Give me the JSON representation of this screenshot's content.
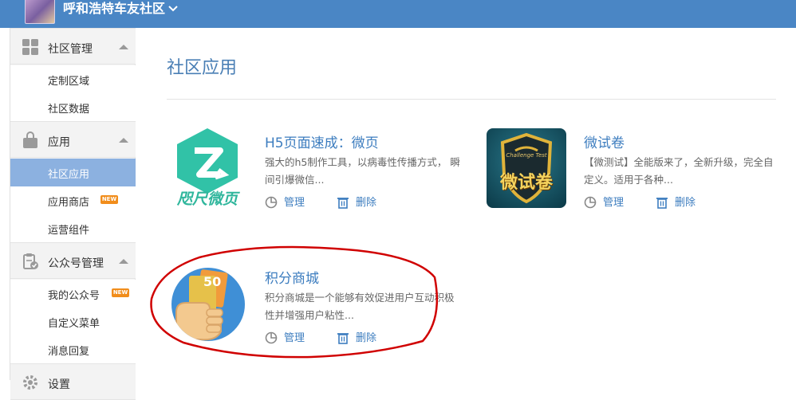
{
  "header": {
    "community_name": "呼和浩特车友社区"
  },
  "sidebar": {
    "sections": [
      {
        "label": "社区管理",
        "icon": "grid-icon",
        "items": [
          {
            "label": "定制区域"
          },
          {
            "label": "社区数据"
          }
        ]
      },
      {
        "label": "应用",
        "icon": "bag-icon",
        "items": [
          {
            "label": "社区应用",
            "active": true
          },
          {
            "label": "应用商店",
            "badge": "NEW"
          },
          {
            "label": "运营组件"
          }
        ]
      },
      {
        "label": "公众号管理",
        "icon": "clipboard-check-icon",
        "items": [
          {
            "label": "我的公众号",
            "badge": "NEW"
          },
          {
            "label": "自定义菜单"
          },
          {
            "label": "消息回复"
          }
        ]
      },
      {
        "label": "设置",
        "icon": "gear-icon"
      }
    ]
  },
  "main": {
    "title": "社区应用",
    "apps": [
      {
        "name": "H5页面速成：微页",
        "desc": "强大的h5制作工具，以病毒性传播方式， 瞬间引爆微信...",
        "manage": "管理",
        "delete": "删除",
        "logo_text": "咫尺微页"
      },
      {
        "name": "微试卷",
        "desc": "【微测试】全能版来了，全新升级，完全自定义。适用于各种...",
        "manage": "管理",
        "delete": "删除",
        "logo_text": "微试卷",
        "logo_sub": "Challenge Test"
      },
      {
        "name": "积分商城",
        "desc": "积分商城是一个能够有效促进用户互动积极性并增强用户粘性...",
        "manage": "管理",
        "delete": "删除",
        "logo_text": "50"
      }
    ]
  },
  "colors": {
    "topbar": "#4a86c5",
    "accent": "#3d7dbf",
    "active_item": "#8cb1e0",
    "badge": "#f18d1b",
    "annotation": "#d00000"
  }
}
